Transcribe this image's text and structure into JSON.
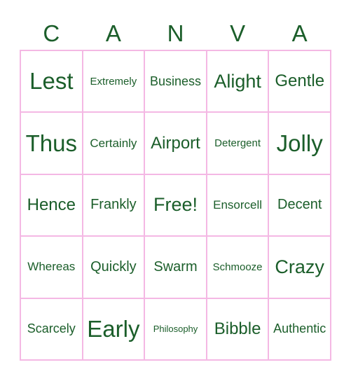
{
  "title_letters": [
    "C",
    "A",
    "N",
    "V",
    "A"
  ],
  "colors": {
    "text": "#1b5e2a",
    "grid": "#f4b8e4"
  },
  "cells": [
    [
      "Lest",
      "Extremely",
      "Business",
      "Alight",
      "Gentle"
    ],
    [
      "Thus",
      "Certainly",
      "Airport",
      "Detergent",
      "Jolly"
    ],
    [
      "Hence",
      "Frankly",
      "Free!",
      "Ensorcell",
      "Decent"
    ],
    [
      "Whereas",
      "Quickly",
      "Swarm",
      "Schmooze",
      "Crazy"
    ],
    [
      "Scarcely",
      "Early",
      "Philosophy",
      "Bibble",
      "Authentic"
    ]
  ]
}
